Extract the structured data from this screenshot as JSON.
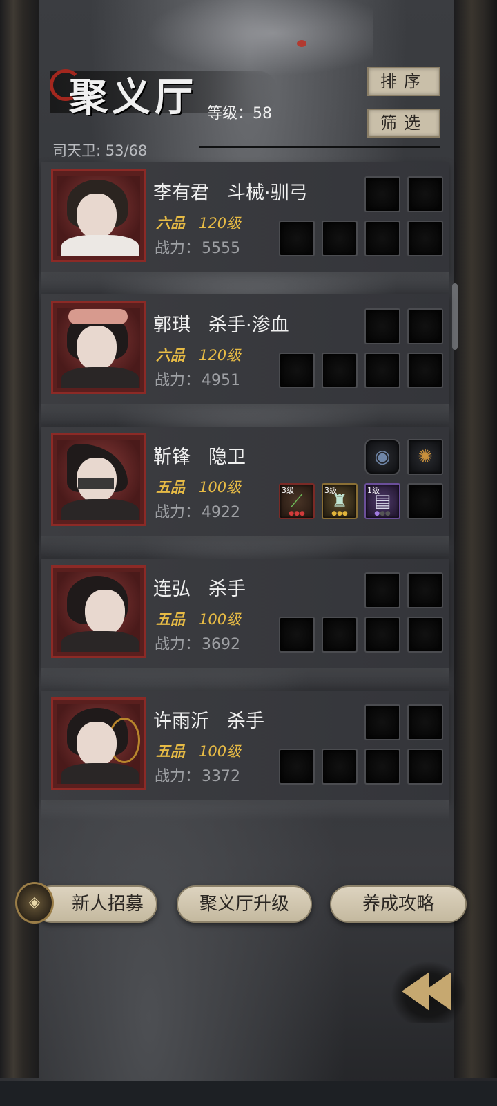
{
  "header": {
    "title": "聚义厅",
    "level_text": "等级：58",
    "guard_text": "司天卫: 53/68",
    "sort_label": "排序",
    "filter_label": "筛选"
  },
  "heroes": [
    {
      "name": "李有君",
      "class": "斗械·驯弓",
      "grade": "六品",
      "level": "120级",
      "power_label": "战力：",
      "power": "5555"
    },
    {
      "name": "郭琪",
      "class": "杀手·渗血",
      "grade": "六品",
      "level": "120级",
      "power_label": "战力：",
      "power": "4951"
    },
    {
      "name": "靳锋",
      "class": "隐卫",
      "grade": "五品",
      "level": "100级",
      "power_label": "战力：",
      "power": "4922",
      "equipment": [
        {
          "slot": "top-1",
          "icon": "eye-amulet-icon"
        },
        {
          "slot": "top-2",
          "icon": "mace-icon"
        },
        {
          "slot": "bottom-1",
          "icon": "green-dagger-icon",
          "level": "3级",
          "stars": 3,
          "star_color": "#d23b3b"
        },
        {
          "slot": "bottom-2",
          "icon": "jade-robe-icon",
          "level": "3级",
          "stars": 3,
          "star_color": "#e1b43a"
        },
        {
          "slot": "bottom-3",
          "icon": "violet-book-icon",
          "level": "1级",
          "stars": 1,
          "star_color": "#a07be0"
        }
      ]
    },
    {
      "name": "连弘",
      "class": "杀手",
      "grade": "五品",
      "level": "100级",
      "power_label": "战力：",
      "power": "3692"
    },
    {
      "name": "许雨沂",
      "class": "杀手",
      "grade": "五品",
      "level": "100级",
      "power_label": "战力：",
      "power": "3372"
    }
  ],
  "bottom_buttons": {
    "recruit": "新人招募",
    "upgrade": "聚义厅升级",
    "guide": "养成攻略"
  },
  "colors": {
    "grade_gold": "#e7bb45",
    "frame_red": "#8c2a26",
    "button_parchment": "#c9bfa9"
  }
}
